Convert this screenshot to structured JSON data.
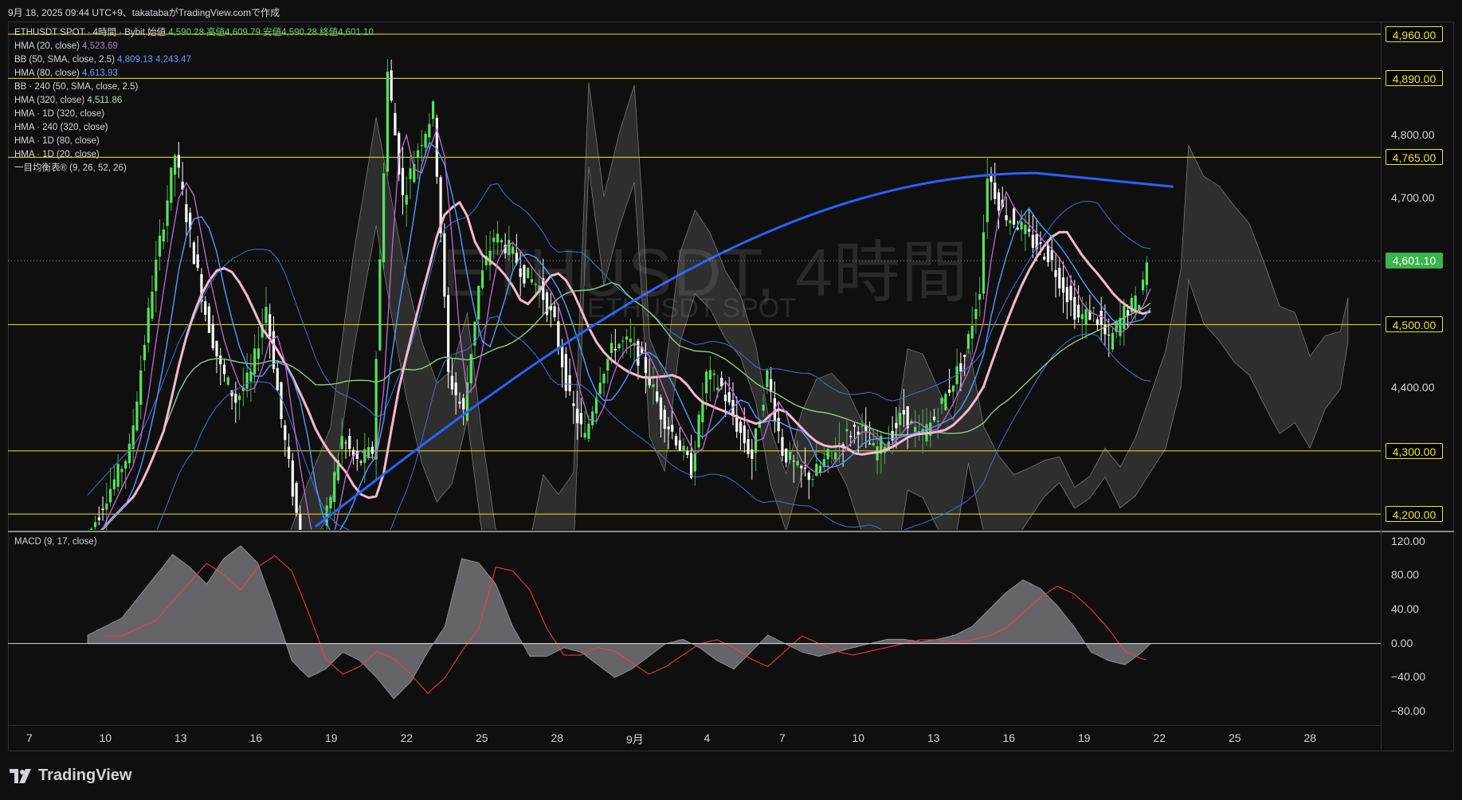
{
  "header": {
    "caption": "9月 18, 2025 09:44 UTC+9、takatabaがTradingView.comで作成"
  },
  "legend": [
    {
      "label": "ETHUSDT SPOT · 4時間 · Bybit  始値",
      "value": "4,590.28 高値4,609.79 安値4,590.28 終値4,601.10",
      "cls": "v-green"
    },
    {
      "label": "HMA (20, close)",
      "value": "4,523.69",
      "cls": "v-purple"
    },
    {
      "label": "BB (50, SMA, close, 2.5)",
      "value": "4,809.13  4,243.47",
      "cls": "v-blue"
    },
    {
      "label": "HMA (80, close)",
      "value": "4,613.93",
      "cls": "v-blue"
    },
    {
      "label": "BB · 240 (50, SMA, close, 2.5)",
      "value": "",
      "cls": ""
    },
    {
      "label": "HMA (320, close)",
      "value": "4,511.86",
      "cls": "v-lime"
    },
    {
      "label": "HMA · 1D (320, close)",
      "value": "",
      "cls": ""
    },
    {
      "label": "HMA · 240 (320, close)",
      "value": "",
      "cls": ""
    },
    {
      "label": "HMA · 1D (80, close)",
      "value": "",
      "cls": ""
    },
    {
      "label": "HMA · 1D (20, close)",
      "value": "",
      "cls": ""
    },
    {
      "label": "一目均衡表® (9, 26, 52, 26)",
      "value": "",
      "cls": ""
    }
  ],
  "watermark": {
    "symbol": "ETHUSDT, 4時間",
    "name": "ETHUSDT SPOT"
  },
  "price_axis": {
    "ticks": [
      "4,890.00",
      "4,800.00",
      "4,700.00",
      "4,400.00"
    ],
    "tick_values": [
      4890,
      4800,
      4700,
      4400
    ],
    "levels": [
      {
        "label": "4,960.00",
        "value": 4960
      },
      {
        "label": "4,890.00",
        "value": 4890
      },
      {
        "label": "4,765.00",
        "value": 4765
      },
      {
        "label": "4,500.00",
        "value": 4500
      },
      {
        "label": "4,300.00",
        "value": 4300
      },
      {
        "label": "4,200.00",
        "value": 4200
      }
    ],
    "last_price": {
      "label": "4,601.10",
      "value": 4601.1
    }
  },
  "macd": {
    "title": "MACD (9, 17, close)",
    "ticks": [
      "120.00",
      "80.00",
      "40.00",
      "0.00",
      "−40.00",
      "−80.00"
    ],
    "tick_values": [
      120,
      80,
      40,
      0,
      -40,
      -80
    ]
  },
  "x_axis": {
    "labels": [
      "7",
      "10",
      "13",
      "16",
      "19",
      "22",
      "25",
      "28",
      "9月",
      "4",
      "7",
      "10",
      "13",
      "16",
      "19",
      "22",
      "25",
      "28"
    ]
  },
  "brand": {
    "name": "TradingView"
  },
  "colors": {
    "up": "#4caf50",
    "down": "#ffffff",
    "level": "#f5e61d",
    "hma20": "#c06ad8",
    "hma80": "#4f9cff",
    "hma320_daily": "#2962ff",
    "pink": "#f7b8cf",
    "bb": "#3a73d9",
    "green_ma": "#86d17f",
    "cloud": "#3a3a3a"
  },
  "chart_data": {
    "type": "candlestick",
    "title": "ETHUSDT SPOT · 4時間 · Bybit",
    "ylim": [
      4175,
      4980
    ],
    "ohlc_last": {
      "open": 4590.28,
      "high": 4609.79,
      "low": 4590.28,
      "close": 4601.1
    },
    "horizontal_levels": [
      4960,
      4890,
      4765,
      4500,
      4300,
      4200
    ],
    "series": [
      {
        "name": "HMA (20, close)",
        "last": 4523.69
      },
      {
        "name": "BB (50, SMA, close, 2.5)",
        "upper": 4809.13,
        "lower": 4243.47
      },
      {
        "name": "HMA (80, close)",
        "last": 4613.93
      },
      {
        "name": "HMA (320, close)",
        "last": 4511.86
      }
    ],
    "path_points": [
      [
        0,
        4150
      ],
      [
        3,
        4230
      ],
      [
        6,
        4300
      ],
      [
        9,
        4560
      ],
      [
        12,
        4770
      ],
      [
        14,
        4640
      ],
      [
        16,
        4520
      ],
      [
        18,
        4430
      ],
      [
        20,
        4380
      ],
      [
        22,
        4420
      ],
      [
        24,
        4530
      ],
      [
        26,
        4350
      ],
      [
        28,
        4200
      ],
      [
        30,
        4080
      ],
      [
        32,
        4200
      ],
      [
        34,
        4320
      ],
      [
        36,
        4280
      ],
      [
        38,
        4300
      ],
      [
        40,
        4900
      ],
      [
        42,
        4700
      ],
      [
        44,
        4780
      ],
      [
        46,
        4840
      ],
      [
        47,
        4650
      ],
      [
        48,
        4420
      ],
      [
        50,
        4360
      ],
      [
        52,
        4560
      ],
      [
        54,
        4640
      ],
      [
        56,
        4620
      ],
      [
        58,
        4580
      ],
      [
        60,
        4560
      ],
      [
        62,
        4500
      ],
      [
        64,
        4380
      ],
      [
        66,
        4320
      ],
      [
        68,
        4420
      ],
      [
        70,
        4470
      ],
      [
        72,
        4470
      ],
      [
        74,
        4430
      ],
      [
        76,
        4360
      ],
      [
        78,
        4320
      ],
      [
        80,
        4270
      ],
      [
        82,
        4420
      ],
      [
        84,
        4400
      ],
      [
        86,
        4340
      ],
      [
        88,
        4290
      ],
      [
        90,
        4420
      ],
      [
        92,
        4300
      ],
      [
        94,
        4270
      ],
      [
        96,
        4260
      ],
      [
        98,
        4290
      ],
      [
        100,
        4320
      ],
      [
        102,
        4340
      ],
      [
        104,
        4300
      ],
      [
        106,
        4320
      ],
      [
        108,
        4360
      ],
      [
        110,
        4320
      ],
      [
        112,
        4350
      ],
      [
        114,
        4400
      ],
      [
        116,
        4450
      ],
      [
        118,
        4560
      ],
      [
        119,
        4740
      ],
      [
        121,
        4680
      ],
      [
        123,
        4660
      ],
      [
        125,
        4630
      ],
      [
        127,
        4610
      ],
      [
        129,
        4560
      ],
      [
        131,
        4510
      ],
      [
        133,
        4520
      ],
      [
        135,
        4470
      ],
      [
        137,
        4520
      ],
      [
        139,
        4540
      ],
      [
        140,
        4601
      ]
    ],
    "macd_points": [
      [
        0,
        10
      ],
      [
        4,
        30
      ],
      [
        8,
        80
      ],
      [
        10,
        105
      ],
      [
        12,
        90
      ],
      [
        14,
        70
      ],
      [
        16,
        100
      ],
      [
        18,
        115
      ],
      [
        20,
        95
      ],
      [
        22,
        40
      ],
      [
        24,
        -20
      ],
      [
        26,
        -40
      ],
      [
        28,
        -30
      ],
      [
        30,
        -10
      ],
      [
        32,
        -20
      ],
      [
        34,
        -40
      ],
      [
        36,
        -65
      ],
      [
        38,
        -45
      ],
      [
        40,
        -10
      ],
      [
        42,
        20
      ],
      [
        44,
        100
      ],
      [
        46,
        95
      ],
      [
        48,
        70
      ],
      [
        50,
        20
      ],
      [
        52,
        -15
      ],
      [
        54,
        -15
      ],
      [
        56,
        -5
      ],
      [
        58,
        -10
      ],
      [
        60,
        -25
      ],
      [
        62,
        -40
      ],
      [
        64,
        -30
      ],
      [
        66,
        -15
      ],
      [
        68,
        0
      ],
      [
        70,
        5
      ],
      [
        72,
        -5
      ],
      [
        74,
        -20
      ],
      [
        76,
        -30
      ],
      [
        78,
        -10
      ],
      [
        80,
        10
      ],
      [
        82,
        0
      ],
      [
        84,
        -10
      ],
      [
        86,
        -15
      ],
      [
        88,
        -10
      ],
      [
        90,
        -5
      ],
      [
        92,
        0
      ],
      [
        94,
        5
      ],
      [
        96,
        5
      ],
      [
        98,
        2
      ],
      [
        100,
        5
      ],
      [
        102,
        10
      ],
      [
        104,
        20
      ],
      [
        106,
        40
      ],
      [
        108,
        60
      ],
      [
        110,
        75
      ],
      [
        112,
        65
      ],
      [
        114,
        45
      ],
      [
        116,
        20
      ],
      [
        118,
        -10
      ],
      [
        120,
        -20
      ],
      [
        122,
        -25
      ],
      [
        124,
        -10
      ],
      [
        125,
        0
      ]
    ]
  }
}
